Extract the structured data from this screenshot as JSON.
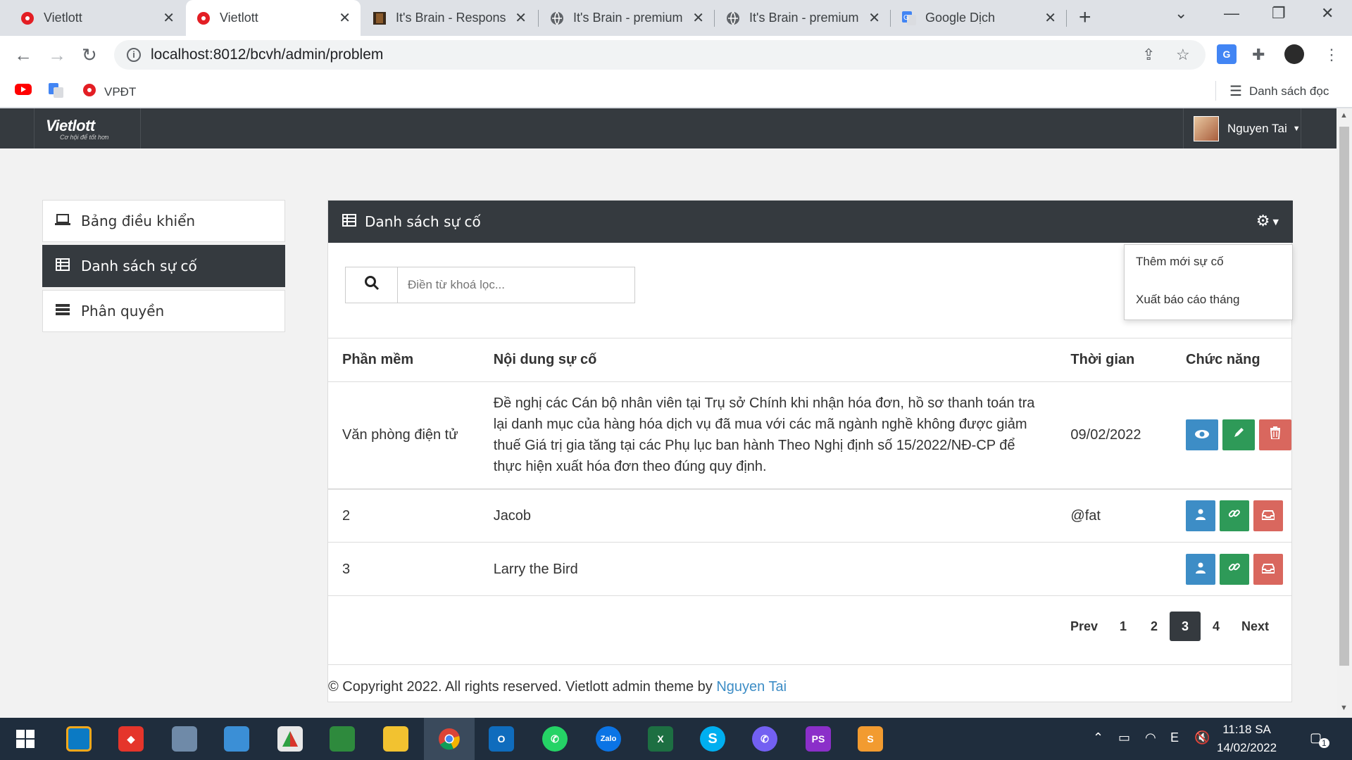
{
  "browser": {
    "tabs": [
      {
        "title": "Vietlott",
        "icon": "vietlott-icon"
      },
      {
        "title": "Vietlott",
        "icon": "vietlott-icon",
        "active": true
      },
      {
        "title": "It's Brain - Respons",
        "icon": "brain-icon"
      },
      {
        "title": "It's Brain - premium",
        "icon": "globe-icon"
      },
      {
        "title": "It's Brain - premium",
        "icon": "globe-icon"
      },
      {
        "title": "Google Dịch",
        "icon": "google-translate-icon"
      }
    ],
    "url": "localhost:8012/bcvh/admin/problem",
    "bookmarks": {
      "vpdt": "VPĐT",
      "reading_list": "Danh sách đọc"
    }
  },
  "header": {
    "brand": "Vietlott",
    "slogan": "Cơ hội để tốt hơn",
    "user_name": "Nguyen Tai"
  },
  "sidebar": {
    "items": [
      {
        "label": "Bảng điều khiển",
        "icon": "laptop-icon"
      },
      {
        "label": "Danh sách sự cố",
        "icon": "table-icon",
        "active": true
      },
      {
        "label": "Phân quyền",
        "icon": "list-icon"
      }
    ]
  },
  "panel": {
    "title": "Danh sách sự cố",
    "menu": {
      "add": "Thêm mới sự cố",
      "export": "Xuất báo cáo tháng"
    },
    "search_placeholder": "Điền từ khoá lọc...",
    "columns": {
      "software": "Phần mềm",
      "content": "Nội dung sự cố",
      "time": "Thời gian",
      "actions": "Chức năng"
    },
    "rows": [
      {
        "software": "Văn phòng điện tử",
        "content": "Đề nghị các Cán bộ nhân viên tại Trụ sở Chính khi nhận hóa đơn, hồ sơ thanh toán tra lại danh mục của hàng hóa dịch vụ đã mua với các mã ngành nghề không được giảm thuế Giá trị gia tăng tại các Phụ lục ban hành Theo Nghị định số 15/2022/NĐ-CP để thực hiện xuất hóa đơn theo đúng quy định.",
        "time": "09/02/2022"
      },
      {
        "software": "2",
        "content": "Jacob",
        "time": "@fat"
      },
      {
        "software": "3",
        "content": "Larry the Bird",
        "time": ""
      }
    ],
    "pagination": {
      "prev": "Prev",
      "pages": [
        "1",
        "2",
        "3",
        "4"
      ],
      "current": "3",
      "next": "Next"
    },
    "footer": {
      "text": "© Copyright 2022. All rights reserved. Vietlott admin theme by",
      "link": "Nguyen Tai"
    }
  },
  "taskbar": {
    "time": "11:18 SA",
    "date": "14/02/2022",
    "notification_count": "1"
  },
  "colors": {
    "dark": "#353a3f",
    "info": "#3d8dc6",
    "success": "#2e9a58",
    "danger": "#d9675e"
  }
}
